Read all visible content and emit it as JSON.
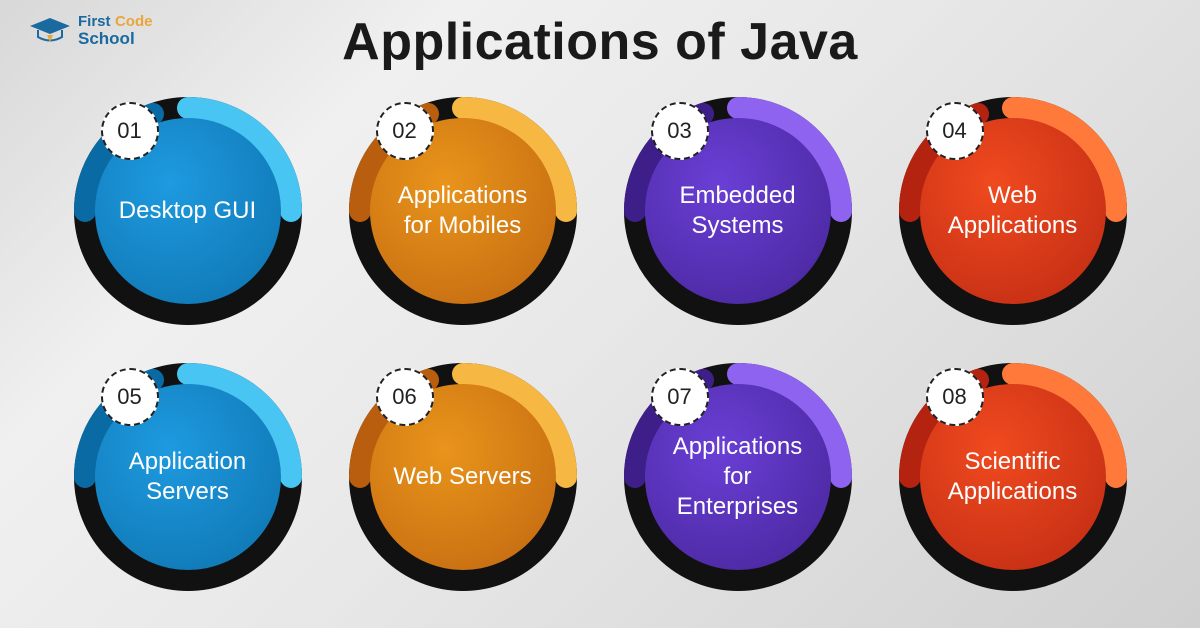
{
  "logo": {
    "text1": "First",
    "text2": "Code",
    "text3": "School"
  },
  "title": "Applications of Java",
  "items": [
    {
      "num": "01",
      "label": "Desktop GUI",
      "fill": "#1e9ae0",
      "ringA": "#0a6aa3",
      "ringB": "#48c5f2"
    },
    {
      "num": "02",
      "label": "Applications for Mobiles",
      "fill": "#e9941b",
      "ringA": "#b85e0e",
      "ringB": "#f7b843"
    },
    {
      "num": "03",
      "label": "Embedded Systems",
      "fill": "#6a3fd6",
      "ringA": "#3e1f8a",
      "ringB": "#8d63f0"
    },
    {
      "num": "04",
      "label": "Web Applications",
      "fill": "#f04a1f",
      "ringA": "#b32310",
      "ringB": "#ff7a3a"
    },
    {
      "num": "05",
      "label": "Application Servers",
      "fill": "#1e9ae0",
      "ringA": "#0a6aa3",
      "ringB": "#48c5f2"
    },
    {
      "num": "06",
      "label": "Web Servers",
      "fill": "#e9941b",
      "ringA": "#b85e0e",
      "ringB": "#f7b843"
    },
    {
      "num": "07",
      "label": "Applications for Enterprises",
      "fill": "#6a3fd6",
      "ringA": "#3e1f8a",
      "ringB": "#8d63f0"
    },
    {
      "num": "08",
      "label": "Scientific Applications",
      "fill": "#f04a1f",
      "ringA": "#b32310",
      "ringB": "#ff7a3a"
    }
  ]
}
